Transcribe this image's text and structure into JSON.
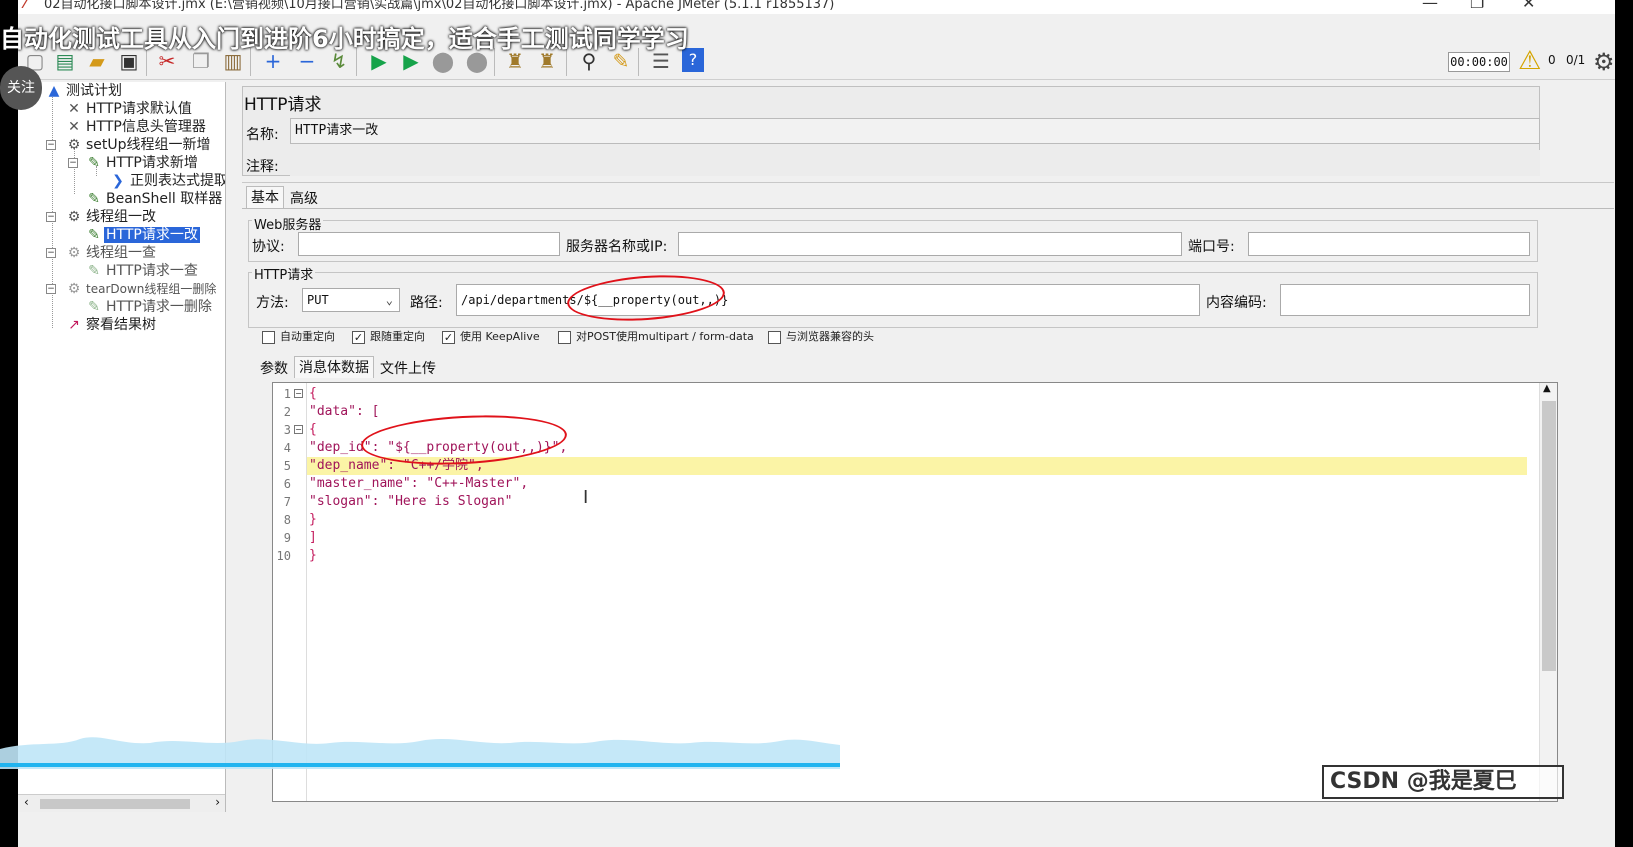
{
  "window": {
    "title": "02自动化接口脚本设计.jmx (E:\\营销视频\\10月接口营销\\实战篇\\jmx\\02自动化接口脚本设计.jmx) - Apache JMeter (5.1.1 r1855137)",
    "minimize": "—",
    "maximize": "❐",
    "close": "✕"
  },
  "overlay": {
    "caption": "自动化测试工具从入门到进阶6小时搞定，适合手工测试同学学习",
    "follow": "关注",
    "watermark": "CSDN @我是夏巳"
  },
  "toolbar": {
    "icons": [
      "new-icon",
      "templates-icon",
      "open-icon",
      "save-icon",
      "cut-icon",
      "copy-icon",
      "paste-icon",
      "expand-icon",
      "collapse-icon",
      "toggle-icon",
      "start-icon",
      "start-no-pause-icon",
      "stop-icon",
      "shutdown-icon",
      "clear-icon",
      "clear-all-icon",
      "search-icon",
      "reset-search-icon",
      "function-helper-icon",
      "help-icon"
    ],
    "timer": "00:00:00",
    "warn_count": "0",
    "thread_ratio": "0/1"
  },
  "tree": {
    "nodes": [
      {
        "label": "测试计划",
        "icon": "test-plan-icon"
      },
      {
        "label": "HTTP请求默认值",
        "icon": "config-icon"
      },
      {
        "label": "HTTP信息头管理器",
        "icon": "config-icon"
      },
      {
        "label": "setUp线程组一新增",
        "icon": "thread-group-icon"
      },
      {
        "label": "HTTP请求新增",
        "icon": "sampler-icon"
      },
      {
        "label": "正则表达式提取",
        "icon": "extractor-icon"
      },
      {
        "label": "BeanShell 取样器",
        "icon": "sampler-icon"
      },
      {
        "label": "线程组一改",
        "icon": "thread-group-icon"
      },
      {
        "label": "HTTP请求一改",
        "icon": "sampler-icon"
      },
      {
        "label": "线程组一查",
        "icon": "thread-group-icon"
      },
      {
        "label": "HTTP请求一查",
        "icon": "sampler-icon"
      },
      {
        "label": "tearDown线程组一删除",
        "icon": "thread-group-icon"
      },
      {
        "label": "HTTP请求一删除",
        "icon": "sampler-icon"
      },
      {
        "label": "察看结果树",
        "icon": "listener-icon"
      }
    ]
  },
  "panel": {
    "title": "HTTP请求",
    "name_label": "名称:",
    "name_value": "HTTP请求一改",
    "comment_label": "注释:",
    "tabs": [
      "基本",
      "高级"
    ],
    "web_server": {
      "title": "Web服务器",
      "protocol_label": "协议:",
      "server_label": "服务器名称或IP:",
      "port_label": "端口号:"
    },
    "http_request": {
      "title": "HTTP请求",
      "method_label": "方法:",
      "method_value": "PUT",
      "path_label": "路径:",
      "path_value": "/api/departments/${__property(out,,)}",
      "encoding_label": "内容编码:"
    },
    "checkboxes": [
      {
        "label": "自动重定向",
        "checked": false
      },
      {
        "label": "跟随重定向",
        "checked": true
      },
      {
        "label": "使用 KeepAlive",
        "checked": true
      },
      {
        "label": "对POST使用multipart / form-data",
        "checked": false
      },
      {
        "label": "与浏览器兼容的头",
        "checked": false
      }
    ],
    "subtabs": [
      "参数",
      "消息体数据",
      "文件上传"
    ],
    "body_lines": [
      "{",
      "\"data\": [",
      "{",
      "\"dep_id\": \"${__property(out,,)}\",",
      "\"dep_name\": \"C++/学院\",",
      "\"master_name\": \"C++-Master\",",
      "\"slogan\": \"Here is Slogan\"",
      "}",
      "]",
      "}"
    ],
    "line_numbers": [
      "1",
      "2",
      "3",
      "4",
      "5",
      "6",
      "7",
      "8",
      "9",
      "10"
    ]
  },
  "colors": {
    "selection": "#2a66d9",
    "highlight_line": "#fbf4a6",
    "annotation": "#e0121a"
  }
}
